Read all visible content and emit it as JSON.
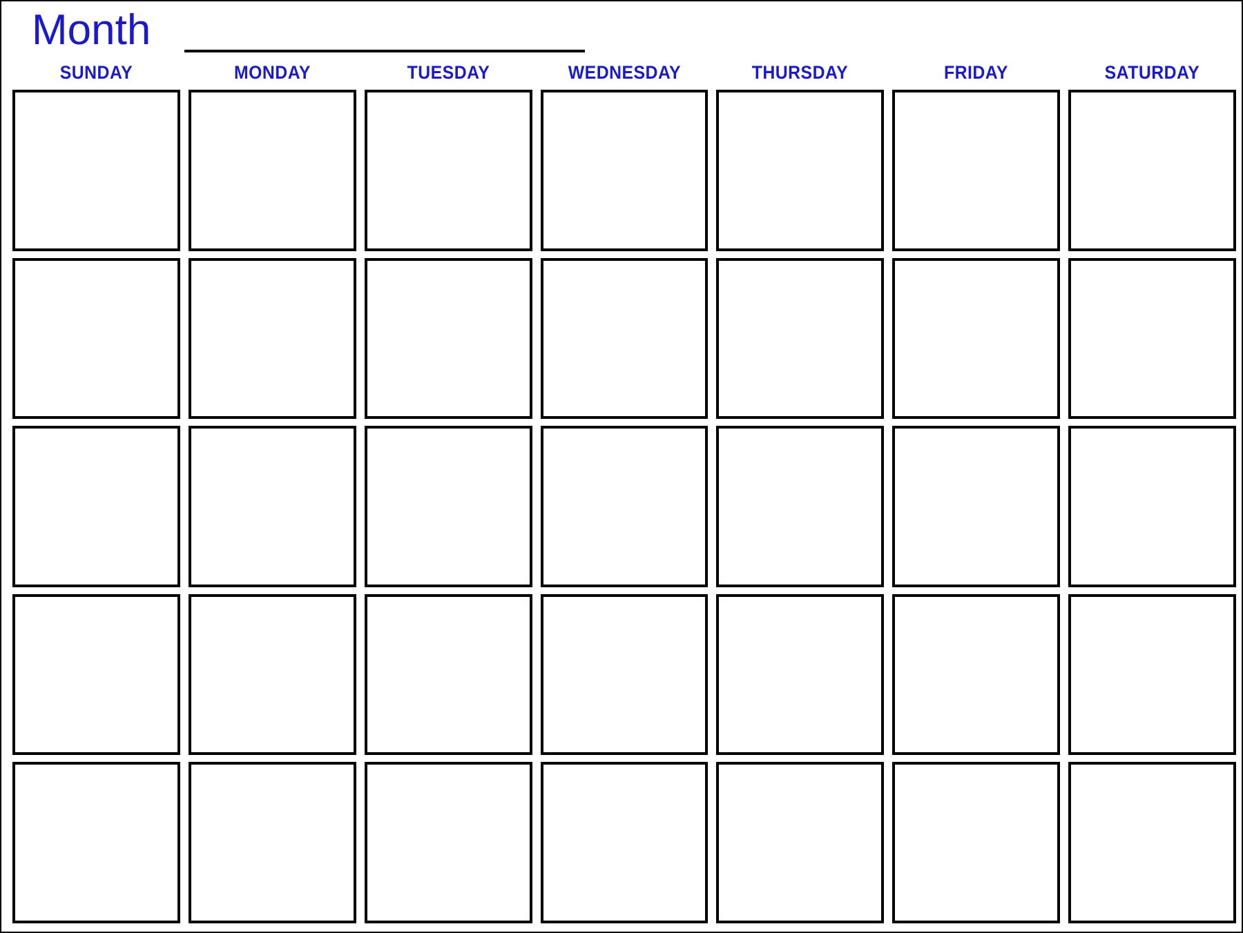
{
  "page": {
    "title": "Blank Monthly Calendar Template",
    "accent_color": "#1a1acc",
    "border_color": "#000000",
    "background_color": "#ffffff"
  },
  "header": {
    "month_label": "Month",
    "month_blank_line": ""
  },
  "weekdays": [
    {
      "label": "SUNDAY"
    },
    {
      "label": "MONDAY"
    },
    {
      "label": "TUESDAY"
    },
    {
      "label": "WEDNESDAY"
    },
    {
      "label": "THURSDAY"
    },
    {
      "label": "FRIDAY"
    },
    {
      "label": "SATURDAY"
    }
  ],
  "grid": {
    "rows": 5,
    "columns": 7,
    "cells": [
      {
        "row": 1,
        "column": 1,
        "weekday": "SUNDAY",
        "content": ""
      },
      {
        "row": 1,
        "column": 2,
        "weekday": "MONDAY",
        "content": ""
      },
      {
        "row": 1,
        "column": 3,
        "weekday": "TUESDAY",
        "content": ""
      },
      {
        "row": 1,
        "column": 4,
        "weekday": "WEDNESDAY",
        "content": ""
      },
      {
        "row": 1,
        "column": 5,
        "weekday": "THURSDAY",
        "content": ""
      },
      {
        "row": 1,
        "column": 6,
        "weekday": "FRIDAY",
        "content": ""
      },
      {
        "row": 1,
        "column": 7,
        "weekday": "SATURDAY",
        "content": ""
      },
      {
        "row": 2,
        "column": 1,
        "weekday": "SUNDAY",
        "content": ""
      },
      {
        "row": 2,
        "column": 2,
        "weekday": "MONDAY",
        "content": ""
      },
      {
        "row": 2,
        "column": 3,
        "weekday": "TUESDAY",
        "content": ""
      },
      {
        "row": 2,
        "column": 4,
        "weekday": "WEDNESDAY",
        "content": ""
      },
      {
        "row": 2,
        "column": 5,
        "weekday": "THURSDAY",
        "content": ""
      },
      {
        "row": 2,
        "column": 6,
        "weekday": "FRIDAY",
        "content": ""
      },
      {
        "row": 2,
        "column": 7,
        "weekday": "SATURDAY",
        "content": ""
      },
      {
        "row": 3,
        "column": 1,
        "weekday": "SUNDAY",
        "content": ""
      },
      {
        "row": 3,
        "column": 2,
        "weekday": "MONDAY",
        "content": ""
      },
      {
        "row": 3,
        "column": 3,
        "weekday": "TUESDAY",
        "content": ""
      },
      {
        "row": 3,
        "column": 4,
        "weekday": "WEDNESDAY",
        "content": ""
      },
      {
        "row": 3,
        "column": 5,
        "weekday": "THURSDAY",
        "content": ""
      },
      {
        "row": 3,
        "column": 6,
        "weekday": "FRIDAY",
        "content": ""
      },
      {
        "row": 3,
        "column": 7,
        "weekday": "SATURDAY",
        "content": ""
      },
      {
        "row": 4,
        "column": 1,
        "weekday": "SUNDAY",
        "content": ""
      },
      {
        "row": 4,
        "column": 2,
        "weekday": "MONDAY",
        "content": ""
      },
      {
        "row": 4,
        "column": 3,
        "weekday": "TUESDAY",
        "content": ""
      },
      {
        "row": 4,
        "column": 4,
        "weekday": "WEDNESDAY",
        "content": ""
      },
      {
        "row": 4,
        "column": 5,
        "weekday": "THURSDAY",
        "content": ""
      },
      {
        "row": 4,
        "column": 6,
        "weekday": "FRIDAY",
        "content": ""
      },
      {
        "row": 4,
        "column": 7,
        "weekday": "SATURDAY",
        "content": ""
      },
      {
        "row": 5,
        "column": 1,
        "weekday": "SUNDAY",
        "content": ""
      },
      {
        "row": 5,
        "column": 2,
        "weekday": "MONDAY",
        "content": ""
      },
      {
        "row": 5,
        "column": 3,
        "weekday": "TUESDAY",
        "content": ""
      },
      {
        "row": 5,
        "column": 4,
        "weekday": "WEDNESDAY",
        "content": ""
      },
      {
        "row": 5,
        "column": 5,
        "weekday": "THURSDAY",
        "content": ""
      },
      {
        "row": 5,
        "column": 6,
        "weekday": "FRIDAY",
        "content": ""
      },
      {
        "row": 5,
        "column": 7,
        "weekday": "SATURDAY",
        "content": ""
      }
    ]
  }
}
